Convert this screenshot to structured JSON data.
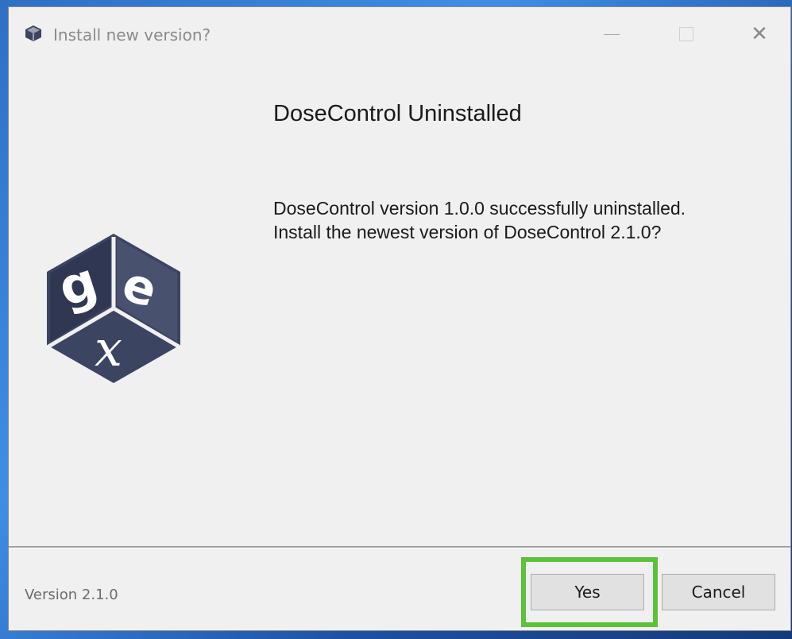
{
  "window": {
    "title": "Install new version?",
    "controls": {
      "minimize": "—",
      "close": "✕"
    }
  },
  "content": {
    "heading": "DoseControl Uninstalled",
    "message_line1": "DoseControl version 1.0.0 successfully uninstalled.",
    "message_line2": "Install the newest version of DoseControl 2.1.0?"
  },
  "logo": {
    "letters": [
      "g",
      "e",
      "x"
    ],
    "color": "#3b4461"
  },
  "footer": {
    "version": "Version 2.1.0"
  },
  "buttons": {
    "yes": "Yes",
    "cancel": "Cancel"
  },
  "highlight_color": "#5dc13c"
}
